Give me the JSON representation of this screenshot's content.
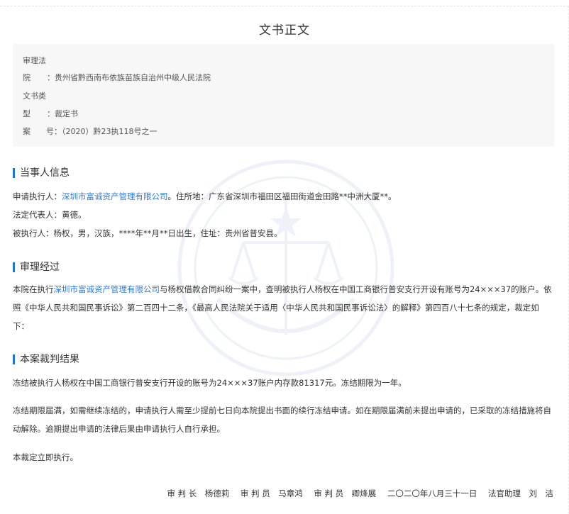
{
  "doc": {
    "title": "文书正文"
  },
  "meta": {
    "court_label_1": "审理法",
    "court_label_2": "院",
    "court_value": "：贵州省黔西南布依族苗族自治州中级人民法院",
    "type_label_1": "文书类",
    "type_label_2": "型",
    "type_value": "：裁定书",
    "case_label": "案　　号：",
    "case_value": "（2020）黔23执118号之一"
  },
  "parties": {
    "heading": "当事人信息",
    "applicant_prefix": "申请执行人：",
    "applicant_link": "深圳市富诚资产管理有限公司",
    "applicant_suffix": "。住所地：广东省深圳市福田区福田街道金田路**中洲大厦**。",
    "legal_rep": "法定代表人：黄德。",
    "respondent": "被执行人：杨权，男，汉族，****年**月**日出生，住址：贵州省普安县。"
  },
  "process": {
    "heading": "审理经过",
    "text_prefix": "本院在执行",
    "text_link": "深圳市富诚资产管理有限公司",
    "text_suffix": "与杨权借款合同纠纷一案中，查明被执行人杨权在中国工商银行普安支行开设有账号为24×××37的账户。依照《中华人民共和国民事诉讼》第二百四十二条，《最高人民法院关于适用〈中华人民共和国民事诉讼法〉的解释》第四百八十七条的规定，裁定如下："
  },
  "result": {
    "heading": "本案裁判结果",
    "p1": "冻结被执行人杨权在中国工商银行普安支行开设的账号为24×××37账户内存款81317元。冻结期限为一年。",
    "p2": "冻结期限届满，如需继续冻结的，申请执行人需至少提前七日向本院提出书面的续行冻结申请。如在期限届满前未提出申请的，已采取的冻结措施将自动解除。逾期提出申请的法律后果由申请执行人自行承担。",
    "p3": "本裁定立即执行。"
  },
  "signatures": {
    "s1": "审 判 长　杨德莉",
    "s2": "审 判 员　马章鸿",
    "s3": "审 判 员　卿烽展",
    "date": "二〇二〇年八月三十一日",
    "s4": "法官助理　刘　洁"
  },
  "colors": {
    "accent": "#1e74d6",
    "link": "#2d7be5",
    "meta_bg": "#f7f7f7"
  }
}
